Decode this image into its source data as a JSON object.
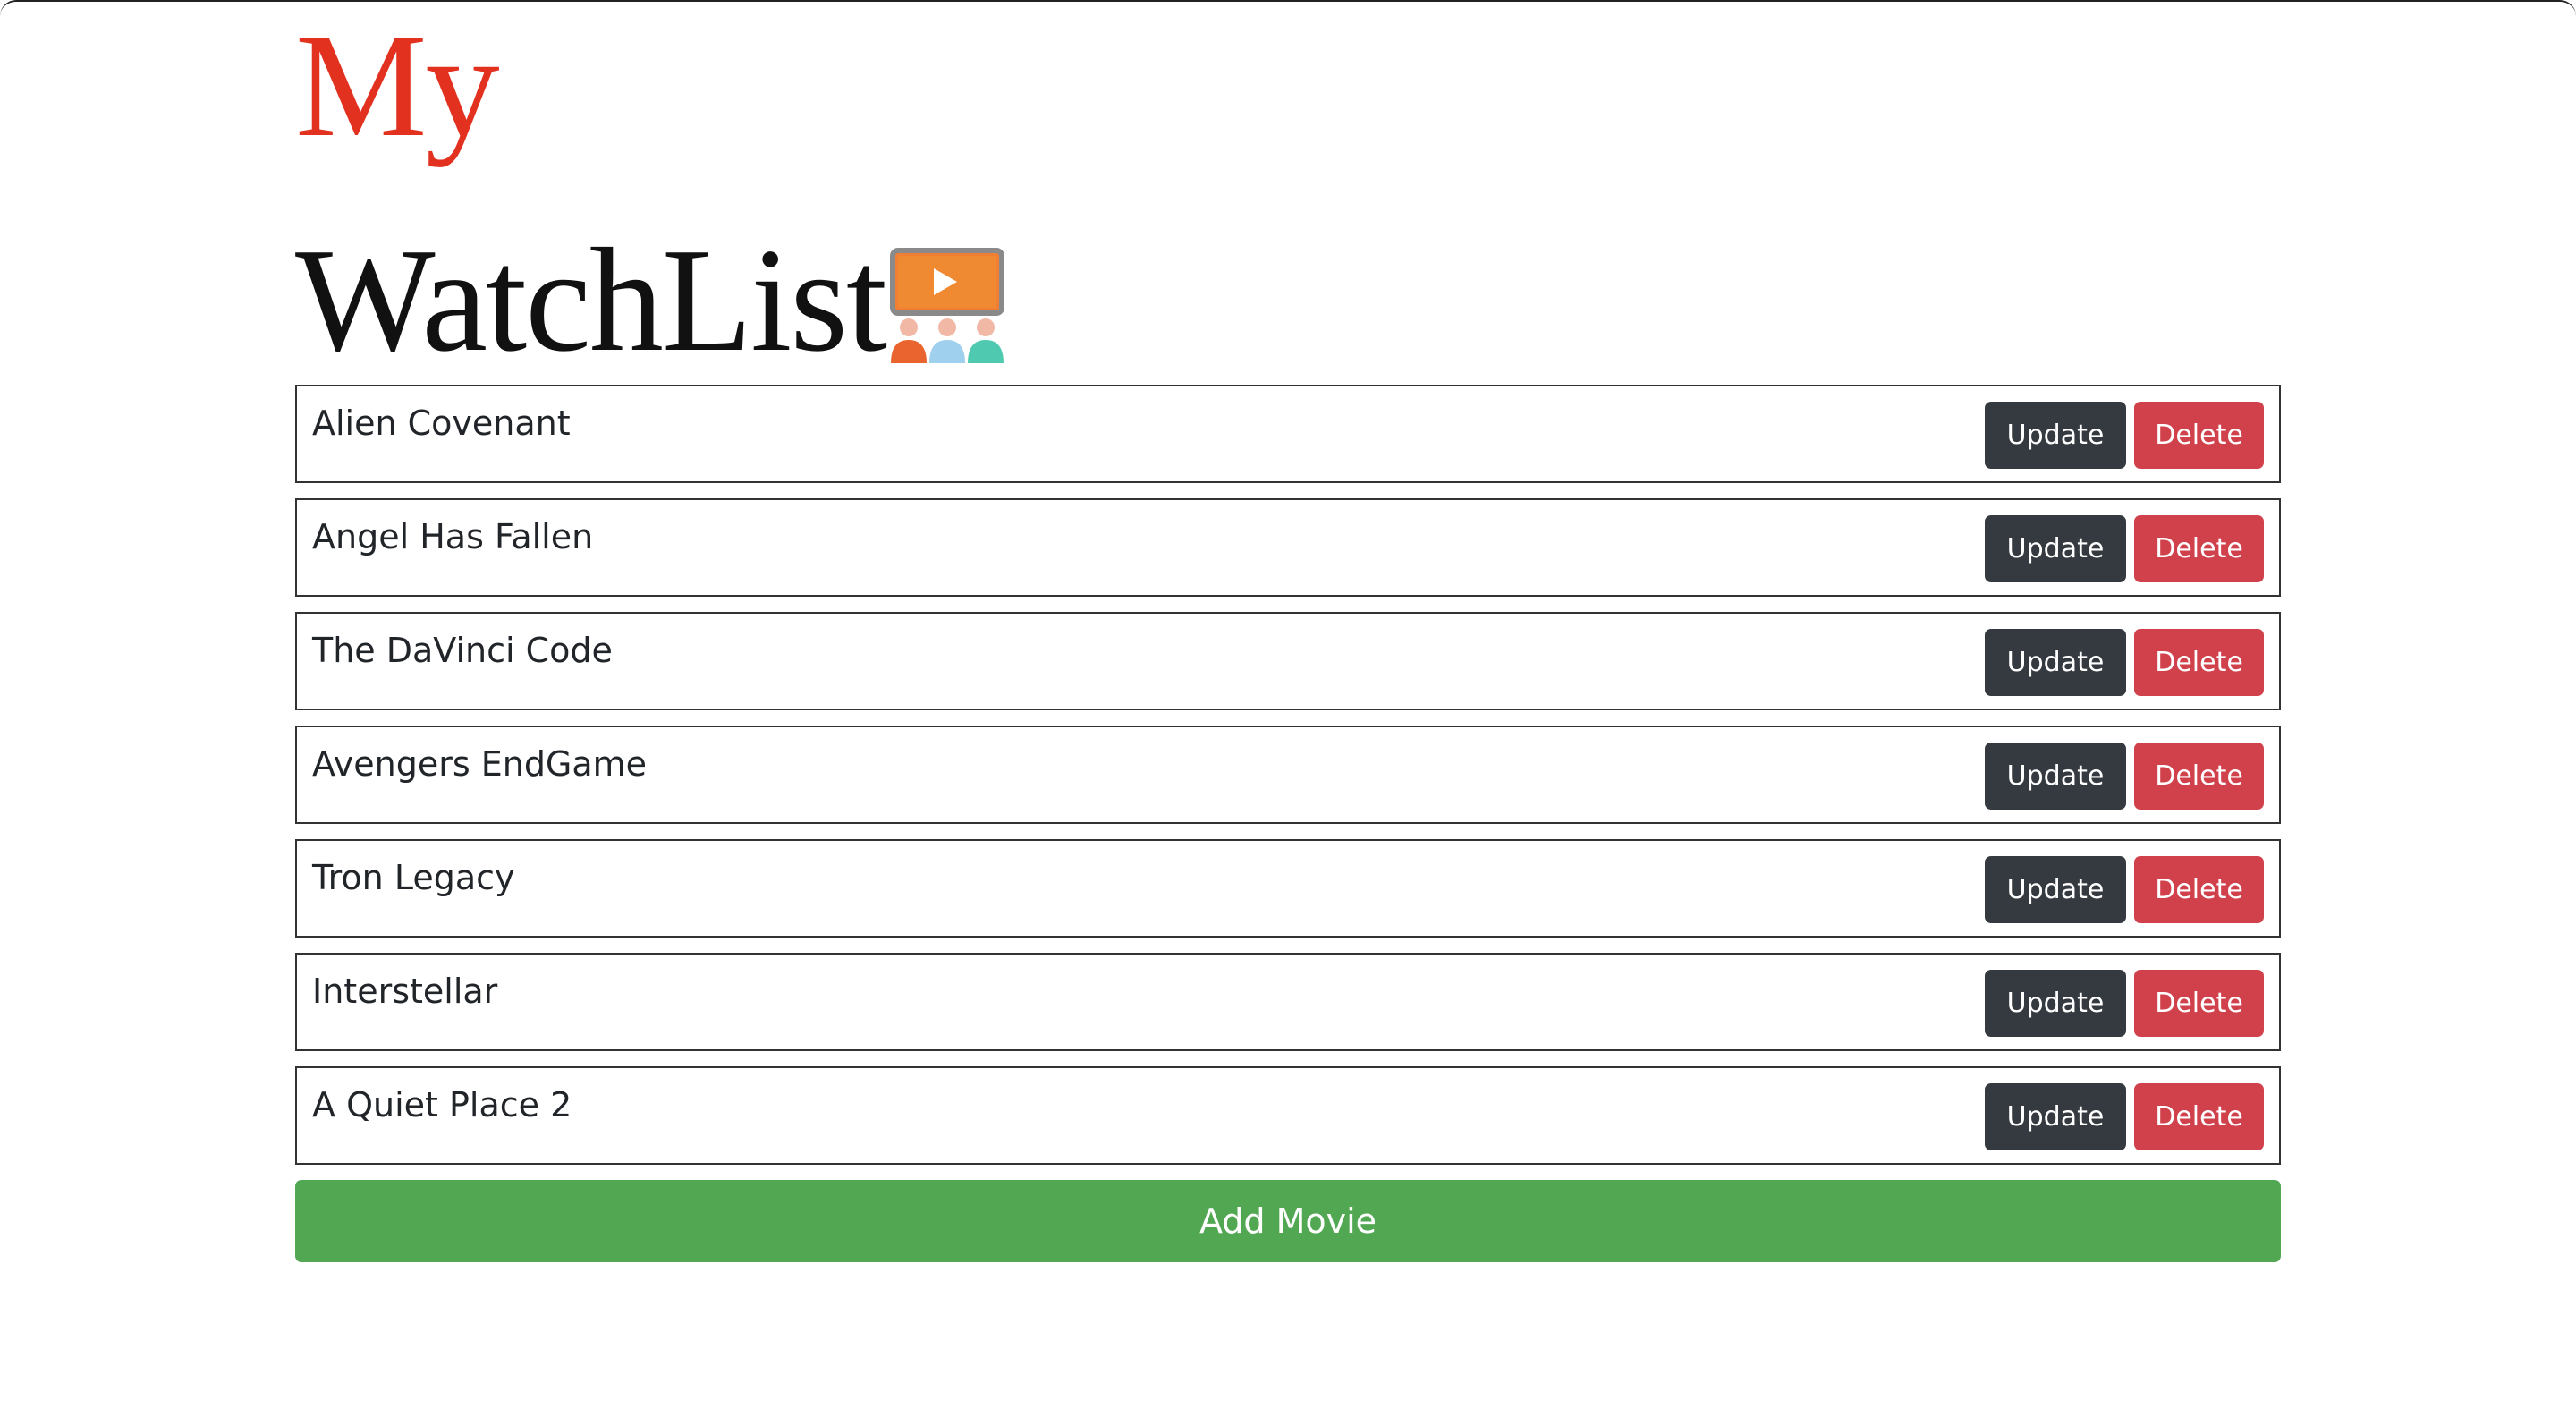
{
  "header": {
    "title_word1": "My",
    "title_word2": "WatchList",
    "icon": "movie-theater-icon",
    "colors": {
      "accent": "#e2321f",
      "text": "#111111"
    }
  },
  "movies": [
    {
      "title": "Alien Covenant"
    },
    {
      "title": "Angel Has Fallen"
    },
    {
      "title": "The DaVinci Code"
    },
    {
      "title": "Avengers EndGame"
    },
    {
      "title": "Tron Legacy"
    },
    {
      "title": "Interstellar"
    },
    {
      "title": "A Quiet Place 2"
    }
  ],
  "actions": {
    "update_label": "Update",
    "delete_label": "Delete",
    "add_label": "Add Movie"
  },
  "colors": {
    "update": "#343a40",
    "delete": "#d0414c",
    "add": "#52a752"
  }
}
